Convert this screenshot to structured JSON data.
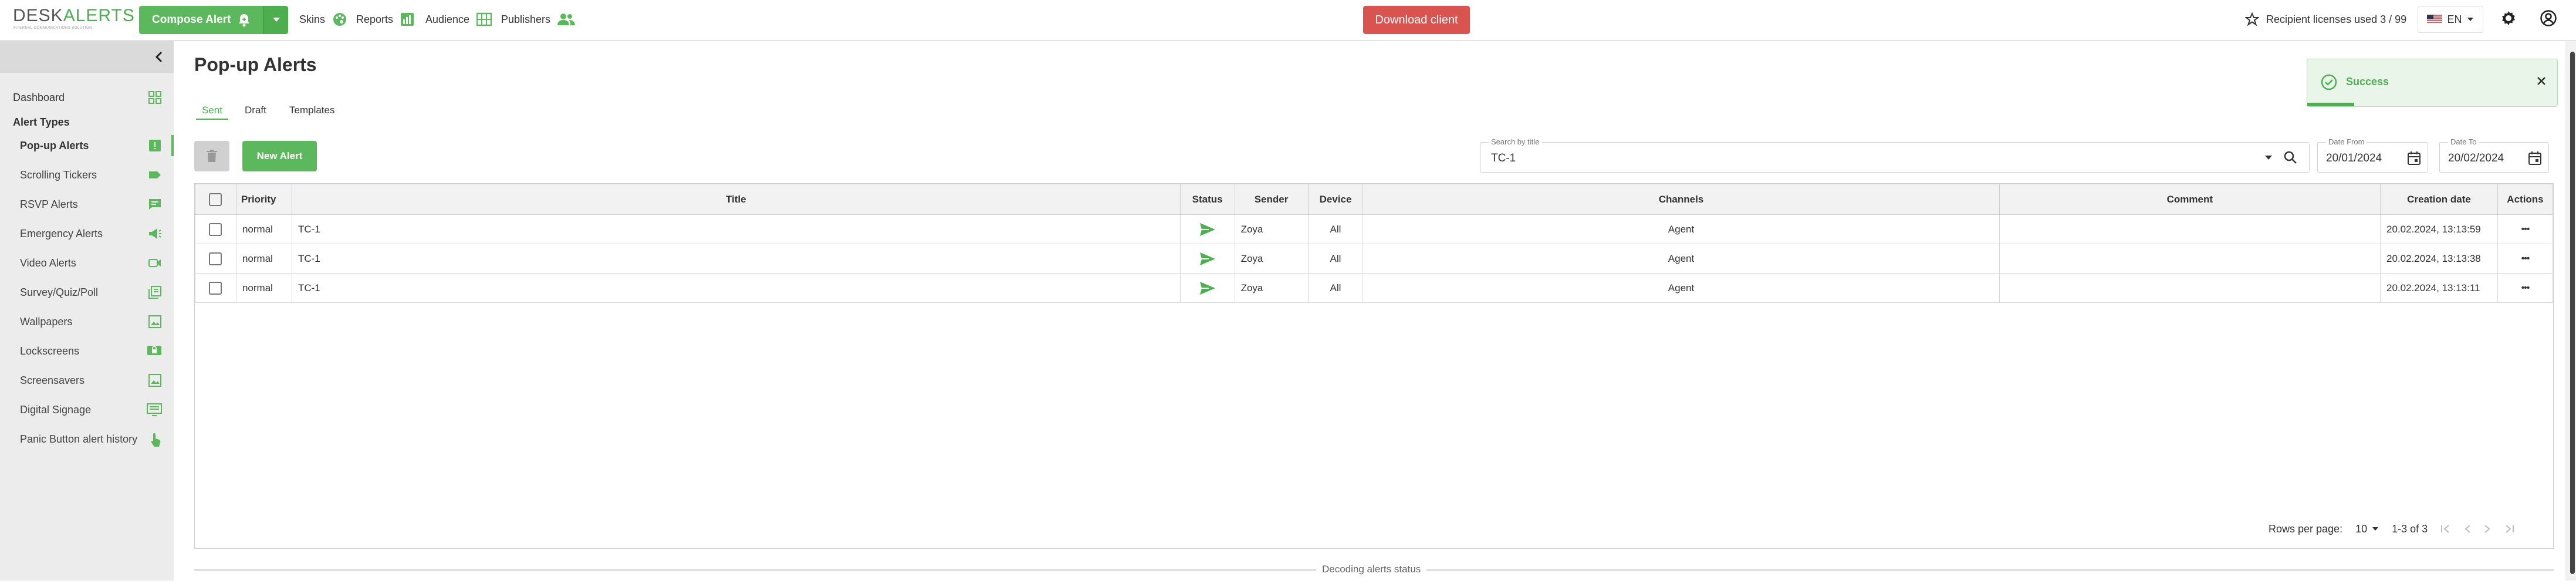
{
  "logo": {
    "left": "DESK",
    "right": "ALERTS",
    "tagline": "INTERNAL COMMUNICATIONS SOLUTION"
  },
  "header": {
    "compose_label": "Compose Alert",
    "nav": [
      {
        "label": "Skins",
        "icon": "palette-icon"
      },
      {
        "label": "Reports",
        "icon": "bar-chart-icon"
      },
      {
        "label": "Audience",
        "icon": "org-chart-icon"
      },
      {
        "label": "Publishers",
        "icon": "people-icon"
      }
    ],
    "download_label": "Download client",
    "licenses_label": "Recipient licenses used 3 / 99",
    "lang": "EN"
  },
  "sidebar": {
    "dashboard": "Dashboard",
    "types_heading": "Alert Types",
    "items": [
      {
        "label": "Pop-up Alerts",
        "icon": "popup-icon"
      },
      {
        "label": "Scrolling Tickers",
        "icon": "ticker-icon"
      },
      {
        "label": "RSVP Alerts",
        "icon": "rsvp-icon"
      },
      {
        "label": "Emergency Alerts",
        "icon": "megaphone-icon"
      },
      {
        "label": "Video Alerts",
        "icon": "video-icon"
      },
      {
        "label": "Survey/Quiz/Poll",
        "icon": "survey-icon"
      },
      {
        "label": "Wallpapers",
        "icon": "wallpaper-icon"
      },
      {
        "label": "Lockscreens",
        "icon": "lockscreen-icon"
      },
      {
        "label": "Screensavers",
        "icon": "screensaver-icon"
      },
      {
        "label": "Digital Signage",
        "icon": "signage-icon"
      },
      {
        "label": "Panic Button alert history",
        "icon": "hand-icon"
      }
    ]
  },
  "main": {
    "title": "Pop-up Alerts",
    "tabs": [
      "Sent",
      "Draft",
      "Templates"
    ],
    "new_alert": "New Alert",
    "search": {
      "label": "Search by title",
      "value": "TC-1"
    },
    "date_from": {
      "label": "Date From",
      "value": "20/01/2024"
    },
    "date_to": {
      "label": "Date To",
      "value": "20/02/2024"
    },
    "columns": [
      "Priority",
      "Title",
      "Status",
      "Sender",
      "Device",
      "Channels",
      "Comment",
      "Creation date",
      "Actions"
    ],
    "rows": [
      {
        "priority": "normal",
        "title": "TC-1",
        "sender": "Zoya",
        "device": "All",
        "channels": "Agent",
        "comment": "",
        "date": "20.02.2024, 13:13:59",
        "actions": "•••"
      },
      {
        "priority": "normal",
        "title": "TC-1",
        "sender": "Zoya",
        "device": "All",
        "channels": "Agent",
        "comment": "",
        "date": "20.02.2024, 13:13:38",
        "actions": "•••"
      },
      {
        "priority": "normal",
        "title": "TC-1",
        "sender": "Zoya",
        "device": "All",
        "channels": "Agent",
        "comment": "",
        "date": "20.02.2024, 13:13:11",
        "actions": "•••"
      }
    ],
    "pager": {
      "rows_label": "Rows per page:",
      "per_page": "10",
      "range": "1-3 of 3"
    },
    "decoding": "Decoding alerts status"
  },
  "toast": {
    "text": "Success"
  },
  "colors": {
    "accent": "#4caf50",
    "danger": "#d9534f"
  }
}
